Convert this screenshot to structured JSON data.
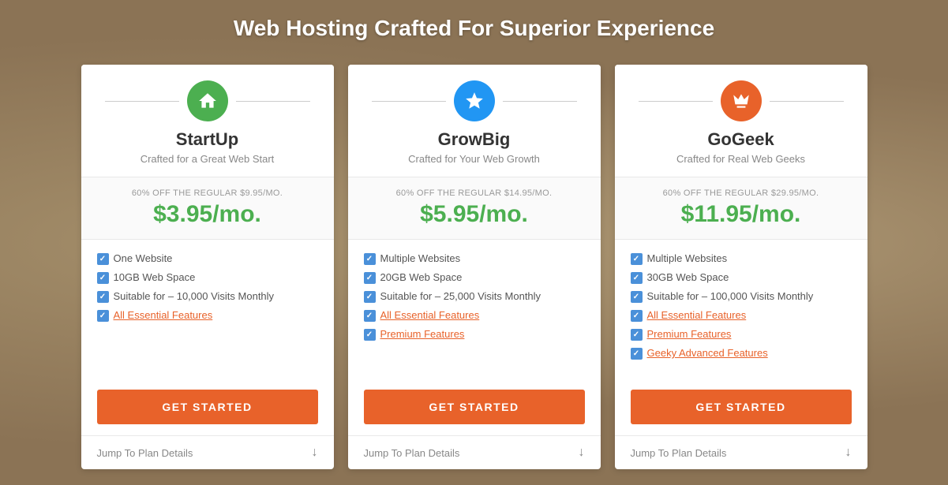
{
  "page": {
    "title": "Web Hosting Crafted For Superior Experience"
  },
  "plans": [
    {
      "id": "startup",
      "icon_type": "green",
      "icon_name": "home",
      "name": "StartUp",
      "tagline": "Crafted for a Great Web Start",
      "discount_text": "60% OFF THE REGULAR $9.95/MO.",
      "price": "$3.95/mo.",
      "features": [
        {
          "text": "One Website",
          "link": false
        },
        {
          "text": "10GB Web Space",
          "link": false
        },
        {
          "text": "Suitable for – 10,000 Visits Monthly",
          "link": false
        },
        {
          "text": "All Essential Features",
          "link": true
        }
      ],
      "cta_label": "GET STARTED",
      "footer_label": "Jump To Plan Details"
    },
    {
      "id": "growbig",
      "icon_type": "blue",
      "icon_name": "star",
      "name": "GrowBig",
      "tagline": "Crafted for Your Web Growth",
      "discount_text": "60% OFF THE REGULAR $14.95/MO.",
      "price": "$5.95/mo.",
      "features": [
        {
          "text": "Multiple Websites",
          "link": false
        },
        {
          "text": "20GB Web Space",
          "link": false
        },
        {
          "text": "Suitable for – 25,000 Visits Monthly",
          "link": false
        },
        {
          "text": "All Essential Features",
          "link": true
        },
        {
          "text": "Premium Features",
          "link": true
        }
      ],
      "cta_label": "GET STARTED",
      "footer_label": "Jump To Plan Details"
    },
    {
      "id": "gogeek",
      "icon_type": "orange",
      "icon_name": "crown",
      "name": "GoGeek",
      "tagline": "Crafted for Real Web Geeks",
      "discount_text": "60% OFF THE REGULAR $29.95/MO.",
      "price": "$11.95/mo.",
      "features": [
        {
          "text": "Multiple Websites",
          "link": false
        },
        {
          "text": "30GB Web Space",
          "link": false
        },
        {
          "text": "Suitable for – 100,000 Visits Monthly",
          "link": false
        },
        {
          "text": "All Essential Features",
          "link": true
        },
        {
          "text": "Premium Features",
          "link": true
        },
        {
          "text": "Geeky Advanced Features",
          "link": true
        }
      ],
      "cta_label": "GET STARTED",
      "footer_label": "Jump To Plan Details"
    }
  ]
}
